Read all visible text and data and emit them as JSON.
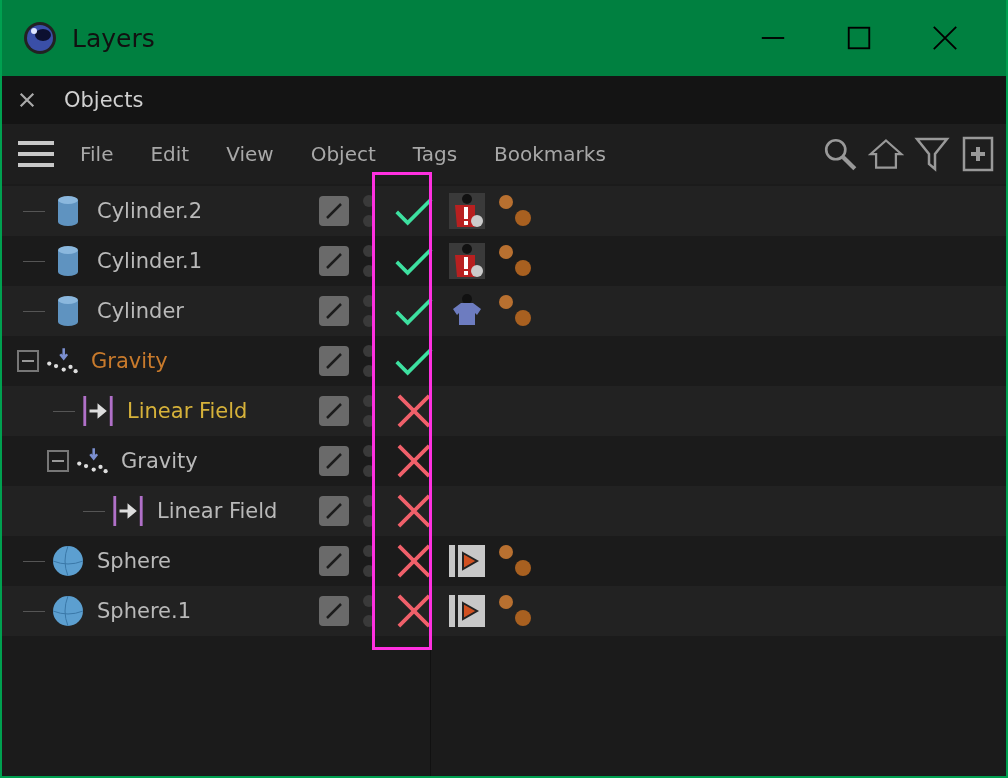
{
  "window": {
    "title": "Layers"
  },
  "panel": {
    "title": "Objects"
  },
  "menu": [
    "File",
    "Edit",
    "View",
    "Object",
    "Tags",
    "Bookmarks"
  ],
  "enabled_column_highlighted": true,
  "objects": [
    {
      "name": "Cylinder.2",
      "kind": "cylinder",
      "color": "#b9b9b9",
      "enabled": true,
      "tags": [
        {
          "kind": "simulation-warning"
        },
        {
          "kind": "material"
        }
      ]
    },
    {
      "name": "Cylinder.1",
      "kind": "cylinder",
      "color": "#b9b9b9",
      "enabled": true,
      "tags": [
        {
          "kind": "simulation-warning"
        },
        {
          "kind": "material"
        }
      ]
    },
    {
      "name": "Cylinder",
      "kind": "cylinder",
      "color": "#b9b9b9",
      "enabled": true,
      "tags": [
        {
          "kind": "shirt"
        },
        {
          "kind": "material"
        }
      ]
    },
    {
      "name": "Gravity",
      "kind": "gravity",
      "color": "#c87a2c",
      "enabled": true,
      "expanded": true,
      "children": [
        {
          "name": "Linear Field",
          "kind": "linear-field",
          "color": "#d6b23a",
          "enabled": false
        },
        {
          "name": "Gravity",
          "kind": "gravity",
          "color": "#b9b9b9",
          "enabled": false,
          "expanded": true,
          "children": [
            {
              "name": "Linear Field",
              "kind": "linear-field",
              "color": "#b9b9b9",
              "enabled": false
            }
          ]
        }
      ]
    },
    {
      "name": "Sphere",
      "kind": "sphere",
      "color": "#b9b9b9",
      "enabled": false,
      "tags": [
        {
          "kind": "play"
        },
        {
          "kind": "material"
        }
      ]
    },
    {
      "name": "Sphere.1",
      "kind": "sphere",
      "color": "#b9b9b9",
      "enabled": false,
      "tags": [
        {
          "kind": "play"
        },
        {
          "kind": "material"
        }
      ]
    }
  ]
}
